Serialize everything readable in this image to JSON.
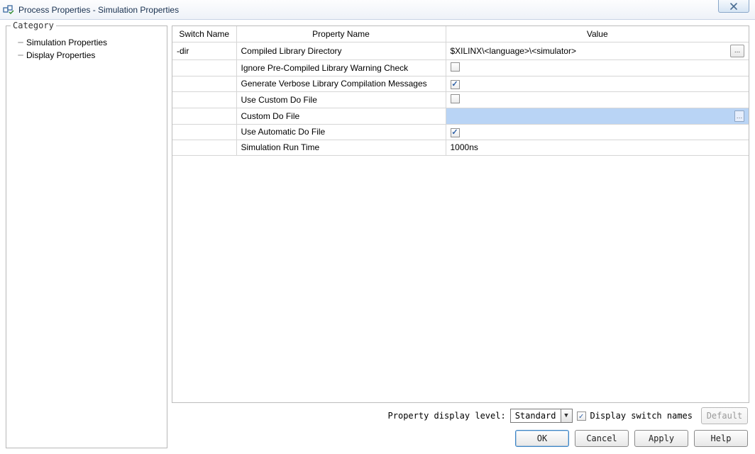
{
  "window": {
    "title": "Process Properties - Simulation Properties"
  },
  "category": {
    "legend": "Category",
    "items": [
      {
        "label": "Simulation Properties"
      },
      {
        "label": "Display Properties"
      }
    ]
  },
  "table": {
    "headers": {
      "switch": "Switch Name",
      "property": "Property Name",
      "value": "Value"
    },
    "rows": [
      {
        "switch": "-dir",
        "name": "Compiled Library Directory",
        "type": "text-browse",
        "value": "$XILINX\\<language>\\<simulator>"
      },
      {
        "switch": "",
        "name": "Ignore Pre-Compiled Library Warning Check",
        "type": "checkbox",
        "checked": false
      },
      {
        "switch": "",
        "name": "Generate Verbose Library Compilation Messages",
        "type": "checkbox",
        "checked": true
      },
      {
        "switch": "",
        "name": "Use Custom Do File",
        "type": "checkbox",
        "checked": false
      },
      {
        "switch": "",
        "name": "Custom Do File",
        "type": "text-browse-small",
        "value": "",
        "selected": true
      },
      {
        "switch": "",
        "name": "Use Automatic Do File",
        "type": "checkbox",
        "checked": true
      },
      {
        "switch": "",
        "name": "Simulation Run Time",
        "type": "text",
        "value": "1000ns"
      }
    ]
  },
  "controls": {
    "display_level_label": "Property display level:",
    "display_level_value": "Standard",
    "display_switch_checked": true,
    "display_switch_label": "Display switch names",
    "default_btn": "Default"
  },
  "buttons": {
    "ok": "OK",
    "cancel": "Cancel",
    "apply": "Apply",
    "help": "Help"
  }
}
